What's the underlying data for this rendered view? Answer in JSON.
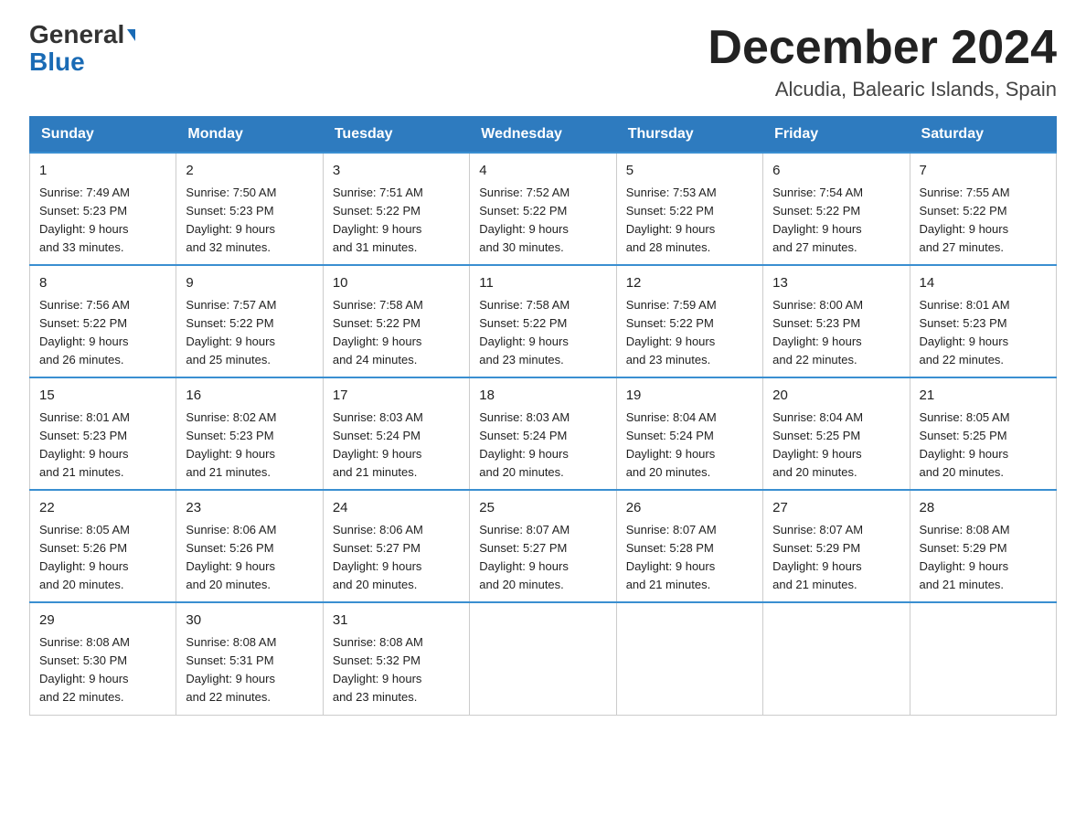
{
  "header": {
    "logo_line1": "General",
    "logo_line2": "Blue",
    "month_title": "December 2024",
    "location": "Alcudia, Balearic Islands, Spain"
  },
  "days_of_week": [
    "Sunday",
    "Monday",
    "Tuesday",
    "Wednesday",
    "Thursday",
    "Friday",
    "Saturday"
  ],
  "weeks": [
    [
      {
        "day": "1",
        "sunrise": "7:49 AM",
        "sunset": "5:23 PM",
        "daylight": "9 hours and 33 minutes."
      },
      {
        "day": "2",
        "sunrise": "7:50 AM",
        "sunset": "5:23 PM",
        "daylight": "9 hours and 32 minutes."
      },
      {
        "day": "3",
        "sunrise": "7:51 AM",
        "sunset": "5:22 PM",
        "daylight": "9 hours and 31 minutes."
      },
      {
        "day": "4",
        "sunrise": "7:52 AM",
        "sunset": "5:22 PM",
        "daylight": "9 hours and 30 minutes."
      },
      {
        "day": "5",
        "sunrise": "7:53 AM",
        "sunset": "5:22 PM",
        "daylight": "9 hours and 28 minutes."
      },
      {
        "day": "6",
        "sunrise": "7:54 AM",
        "sunset": "5:22 PM",
        "daylight": "9 hours and 27 minutes."
      },
      {
        "day": "7",
        "sunrise": "7:55 AM",
        "sunset": "5:22 PM",
        "daylight": "9 hours and 27 minutes."
      }
    ],
    [
      {
        "day": "8",
        "sunrise": "7:56 AM",
        "sunset": "5:22 PM",
        "daylight": "9 hours and 26 minutes."
      },
      {
        "day": "9",
        "sunrise": "7:57 AM",
        "sunset": "5:22 PM",
        "daylight": "9 hours and 25 minutes."
      },
      {
        "day": "10",
        "sunrise": "7:58 AM",
        "sunset": "5:22 PM",
        "daylight": "9 hours and 24 minutes."
      },
      {
        "day": "11",
        "sunrise": "7:58 AM",
        "sunset": "5:22 PM",
        "daylight": "9 hours and 23 minutes."
      },
      {
        "day": "12",
        "sunrise": "7:59 AM",
        "sunset": "5:22 PM",
        "daylight": "9 hours and 23 minutes."
      },
      {
        "day": "13",
        "sunrise": "8:00 AM",
        "sunset": "5:23 PM",
        "daylight": "9 hours and 22 minutes."
      },
      {
        "day": "14",
        "sunrise": "8:01 AM",
        "sunset": "5:23 PM",
        "daylight": "9 hours and 22 minutes."
      }
    ],
    [
      {
        "day": "15",
        "sunrise": "8:01 AM",
        "sunset": "5:23 PM",
        "daylight": "9 hours and 21 minutes."
      },
      {
        "day": "16",
        "sunrise": "8:02 AM",
        "sunset": "5:23 PM",
        "daylight": "9 hours and 21 minutes."
      },
      {
        "day": "17",
        "sunrise": "8:03 AM",
        "sunset": "5:24 PM",
        "daylight": "9 hours and 21 minutes."
      },
      {
        "day": "18",
        "sunrise": "8:03 AM",
        "sunset": "5:24 PM",
        "daylight": "9 hours and 20 minutes."
      },
      {
        "day": "19",
        "sunrise": "8:04 AM",
        "sunset": "5:24 PM",
        "daylight": "9 hours and 20 minutes."
      },
      {
        "day": "20",
        "sunrise": "8:04 AM",
        "sunset": "5:25 PM",
        "daylight": "9 hours and 20 minutes."
      },
      {
        "day": "21",
        "sunrise": "8:05 AM",
        "sunset": "5:25 PM",
        "daylight": "9 hours and 20 minutes."
      }
    ],
    [
      {
        "day": "22",
        "sunrise": "8:05 AM",
        "sunset": "5:26 PM",
        "daylight": "9 hours and 20 minutes."
      },
      {
        "day": "23",
        "sunrise": "8:06 AM",
        "sunset": "5:26 PM",
        "daylight": "9 hours and 20 minutes."
      },
      {
        "day": "24",
        "sunrise": "8:06 AM",
        "sunset": "5:27 PM",
        "daylight": "9 hours and 20 minutes."
      },
      {
        "day": "25",
        "sunrise": "8:07 AM",
        "sunset": "5:27 PM",
        "daylight": "9 hours and 20 minutes."
      },
      {
        "day": "26",
        "sunrise": "8:07 AM",
        "sunset": "5:28 PM",
        "daylight": "9 hours and 21 minutes."
      },
      {
        "day": "27",
        "sunrise": "8:07 AM",
        "sunset": "5:29 PM",
        "daylight": "9 hours and 21 minutes."
      },
      {
        "day": "28",
        "sunrise": "8:08 AM",
        "sunset": "5:29 PM",
        "daylight": "9 hours and 21 minutes."
      }
    ],
    [
      {
        "day": "29",
        "sunrise": "8:08 AM",
        "sunset": "5:30 PM",
        "daylight": "9 hours and 22 minutes."
      },
      {
        "day": "30",
        "sunrise": "8:08 AM",
        "sunset": "5:31 PM",
        "daylight": "9 hours and 22 minutes."
      },
      {
        "day": "31",
        "sunrise": "8:08 AM",
        "sunset": "5:32 PM",
        "daylight": "9 hours and 23 minutes."
      },
      null,
      null,
      null,
      null
    ]
  ],
  "labels": {
    "sunrise_prefix": "Sunrise: ",
    "sunset_prefix": "Sunset: ",
    "daylight_prefix": "Daylight: "
  }
}
